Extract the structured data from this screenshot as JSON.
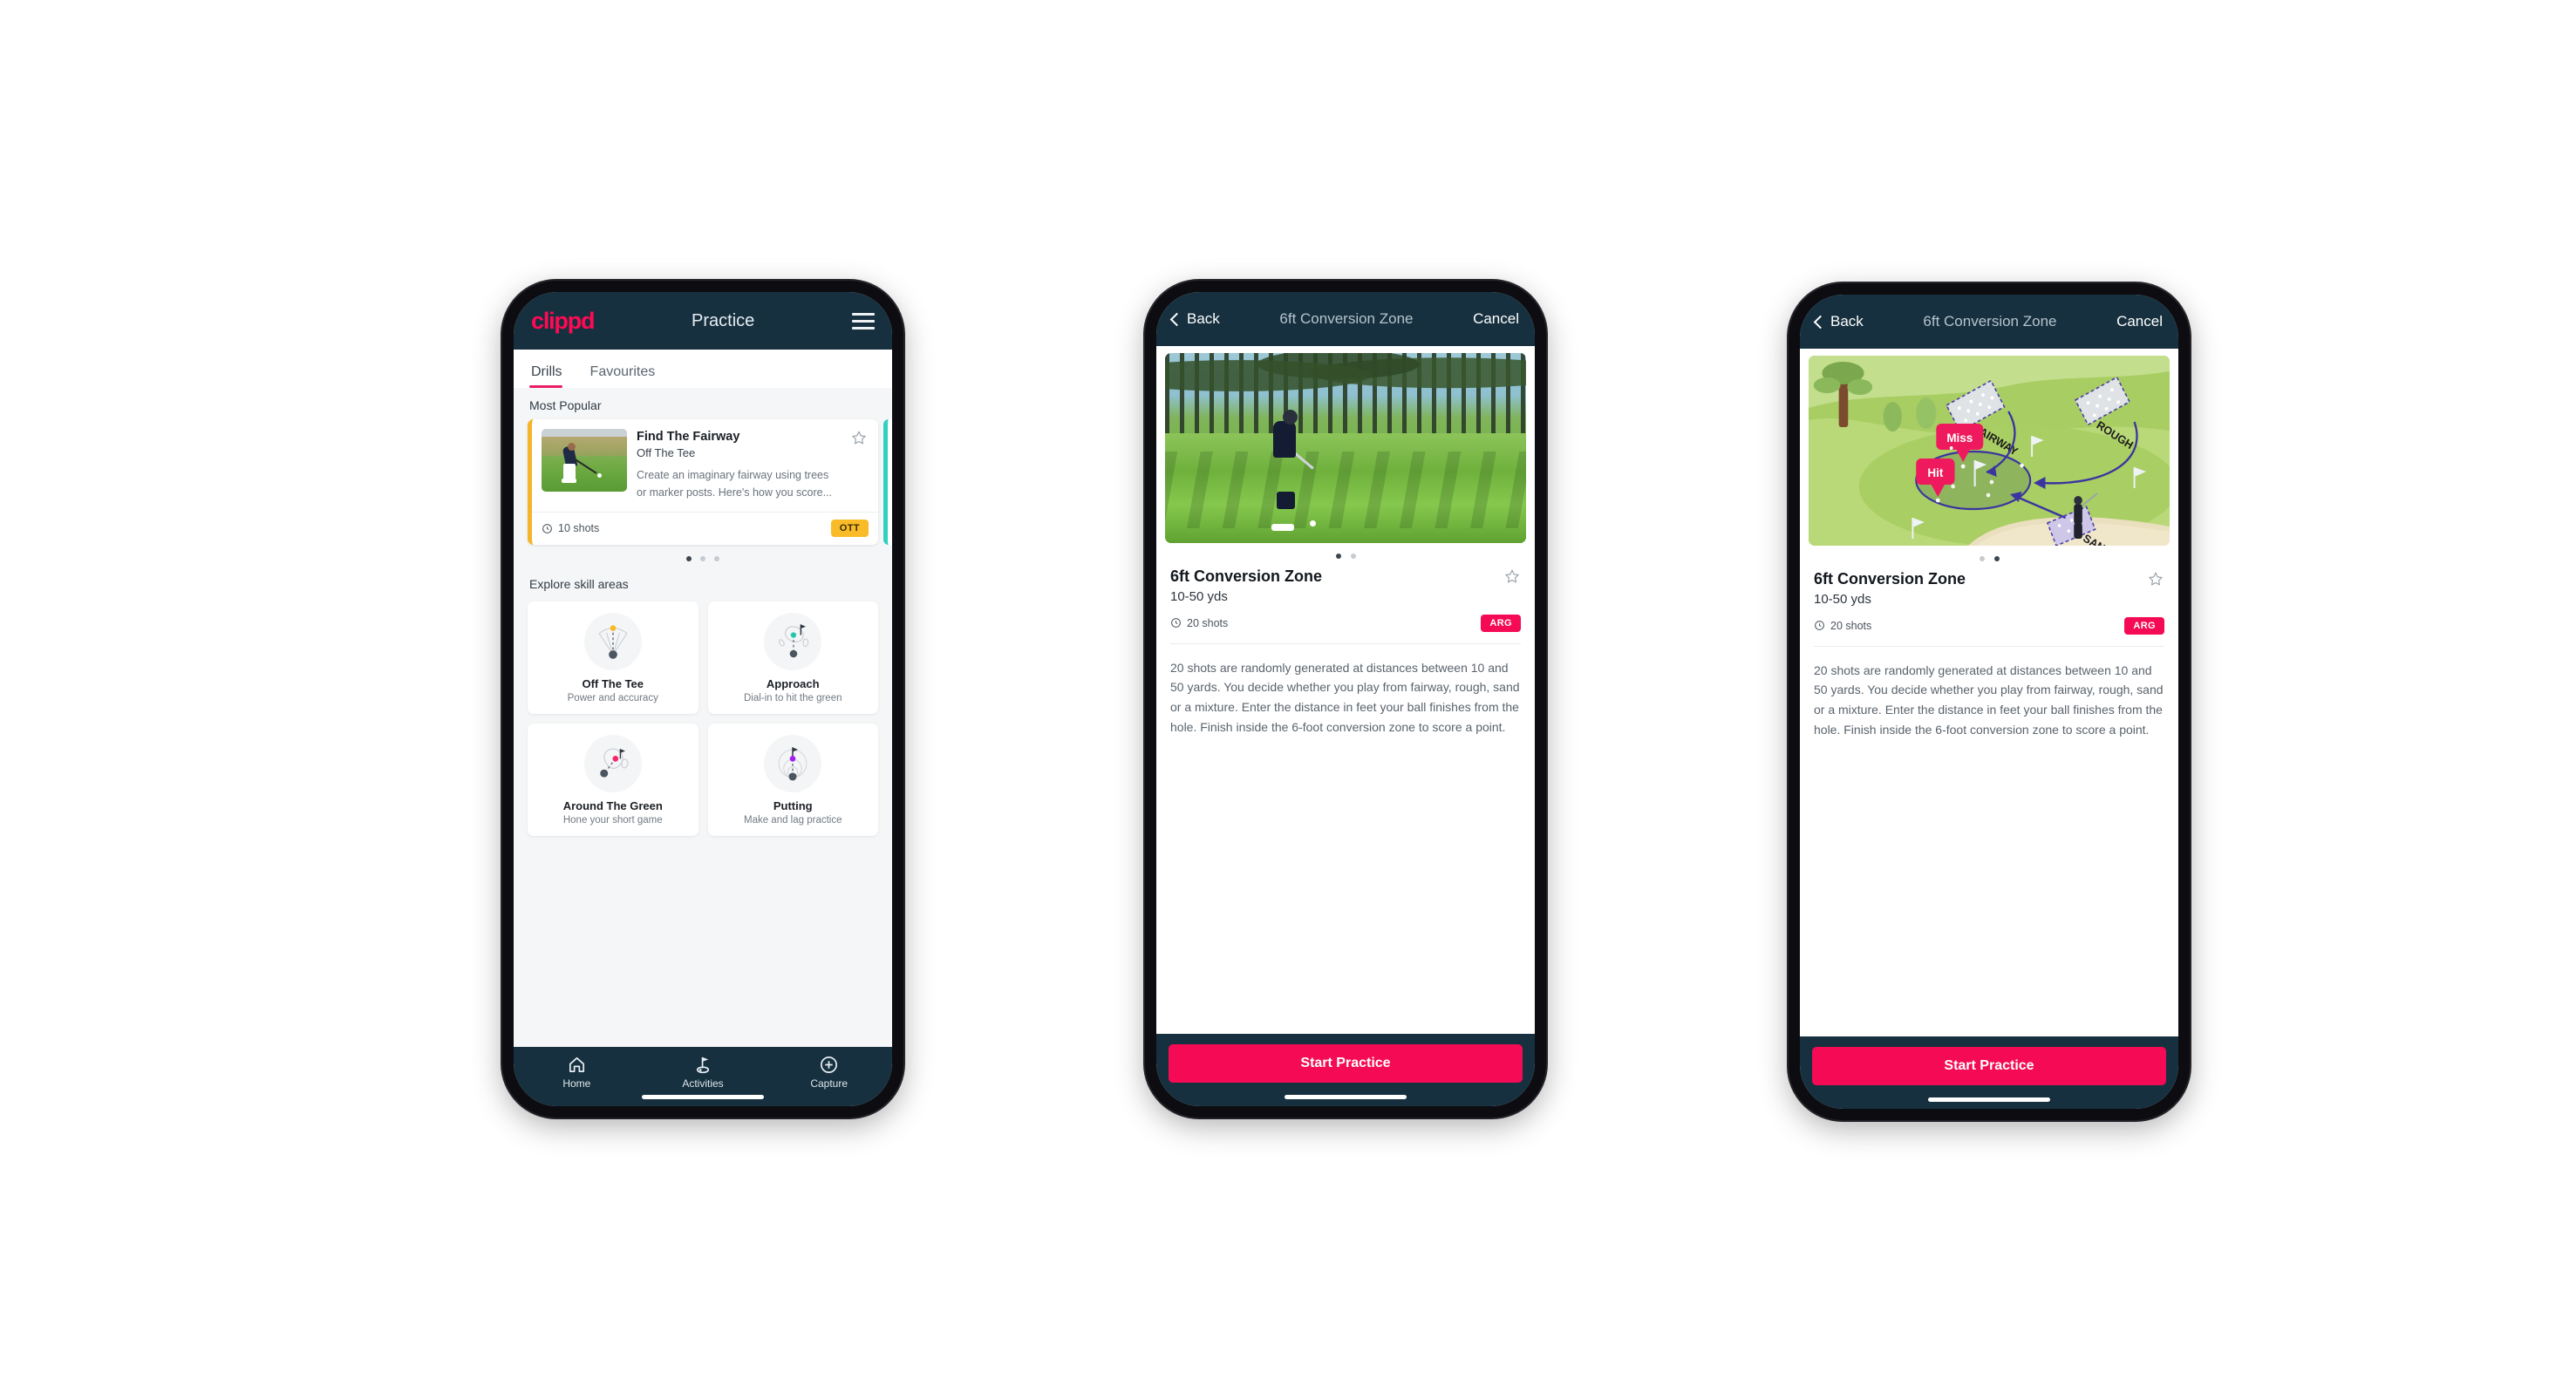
{
  "phone1": {
    "topbar": {
      "brand": "clippd",
      "title": "Practice",
      "menu_icon": "hamburger-icon"
    },
    "tabs": [
      {
        "label": "Drills",
        "active": true
      },
      {
        "label": "Favourites",
        "active": false
      }
    ],
    "most_popular": {
      "section_title": "Most Popular",
      "card": {
        "title": "Find The Fairway",
        "subtitle": "Off The Tee",
        "description": "Create an imaginary fairway using trees or marker posts. Here's how you score...",
        "shots": "10 shots",
        "pill": "OTT",
        "accent_color": "#f5b52a",
        "next_card_accent": "#31d0c0",
        "favourite_icon": "star-outline-icon",
        "shots_icon": "clock-icon"
      },
      "pagination": {
        "count": 3,
        "active_index": 0
      }
    },
    "explore": {
      "section_title": "Explore skill areas",
      "cards": [
        {
          "name": "Off The Tee",
          "desc": "Power and accuracy",
          "icon": "tee-shot-fan-icon",
          "dot_color": "#f9bb27"
        },
        {
          "name": "Approach",
          "desc": "Dial-in to hit the green",
          "icon": "approach-green-icon",
          "dot_color": "#22c7a9"
        },
        {
          "name": "Around The Green",
          "desc": "Hone your short game",
          "icon": "around-green-icon",
          "dot_color": "#f5276a"
        },
        {
          "name": "Putting",
          "desc": "Make and lag practice",
          "icon": "putting-rings-icon",
          "dot_color": "#a020f0"
        }
      ]
    },
    "bottomnav": [
      {
        "label": "Home",
        "icon": "home-icon",
        "active": false
      },
      {
        "label": "Activities",
        "icon": "golf-flag-icon",
        "active": true
      },
      {
        "label": "Capture",
        "icon": "plus-circle-icon",
        "active": false
      }
    ]
  },
  "phone2": {
    "topbar": {
      "back_label": "Back",
      "back_icon": "chevron-left-icon",
      "title": "6ft Conversion Zone",
      "cancel_label": "Cancel"
    },
    "hero": {
      "type": "photo",
      "alt": "golfer-chipping-photo"
    },
    "pagination": {
      "count": 2,
      "active_index": 0
    },
    "detail": {
      "title": "6ft Conversion Zone",
      "yardage": "10-50 yds",
      "shots": "20 shots",
      "pill": "ARG",
      "favourite_icon": "star-outline-icon",
      "shots_icon": "clock-icon",
      "description": "20 shots are randomly generated at distances between 10 and 50 yards. You decide whether you play from fairway, rough, sand or a mixture. Enter the distance in feet your ball finishes from the hole. Finish inside the 6-foot conversion zone to score a point."
    },
    "cta": {
      "label": "Start Practice",
      "color": "#f50a55"
    }
  },
  "phone3": {
    "topbar": {
      "back_label": "Back",
      "back_icon": "chevron-left-icon",
      "title": "6ft Conversion Zone",
      "cancel_label": "Cancel"
    },
    "hero": {
      "type": "illustration",
      "alt": "golf-course-diagram",
      "labels": {
        "fairway": "FAIRWAY",
        "rough": "ROUGH",
        "sand": "SAND",
        "miss": "Miss",
        "hit": "Hit"
      }
    },
    "pagination": {
      "count": 2,
      "active_index": 1
    },
    "detail": {
      "title": "6ft Conversion Zone",
      "yardage": "10-50 yds",
      "shots": "20 shots",
      "pill": "ARG",
      "favourite_icon": "star-outline-icon",
      "shots_icon": "clock-icon",
      "description": "20 shots are randomly generated at distances between 10 and 50 yards. You decide whether you play from fairway, rough, sand or a mixture. Enter the distance in feet your ball finishes from the hole. Finish inside the 6-foot conversion zone to score a point."
    },
    "cta": {
      "label": "Start Practice",
      "color": "#f50a55"
    }
  },
  "theme": {
    "brand_pink": "#ff0a54",
    "header_navy": "#16303f",
    "page_bg": "#f5f6f7",
    "ott_yellow": "#f9bb27",
    "arg_pink": "#f50a55",
    "teal": "#31d0c0"
  }
}
